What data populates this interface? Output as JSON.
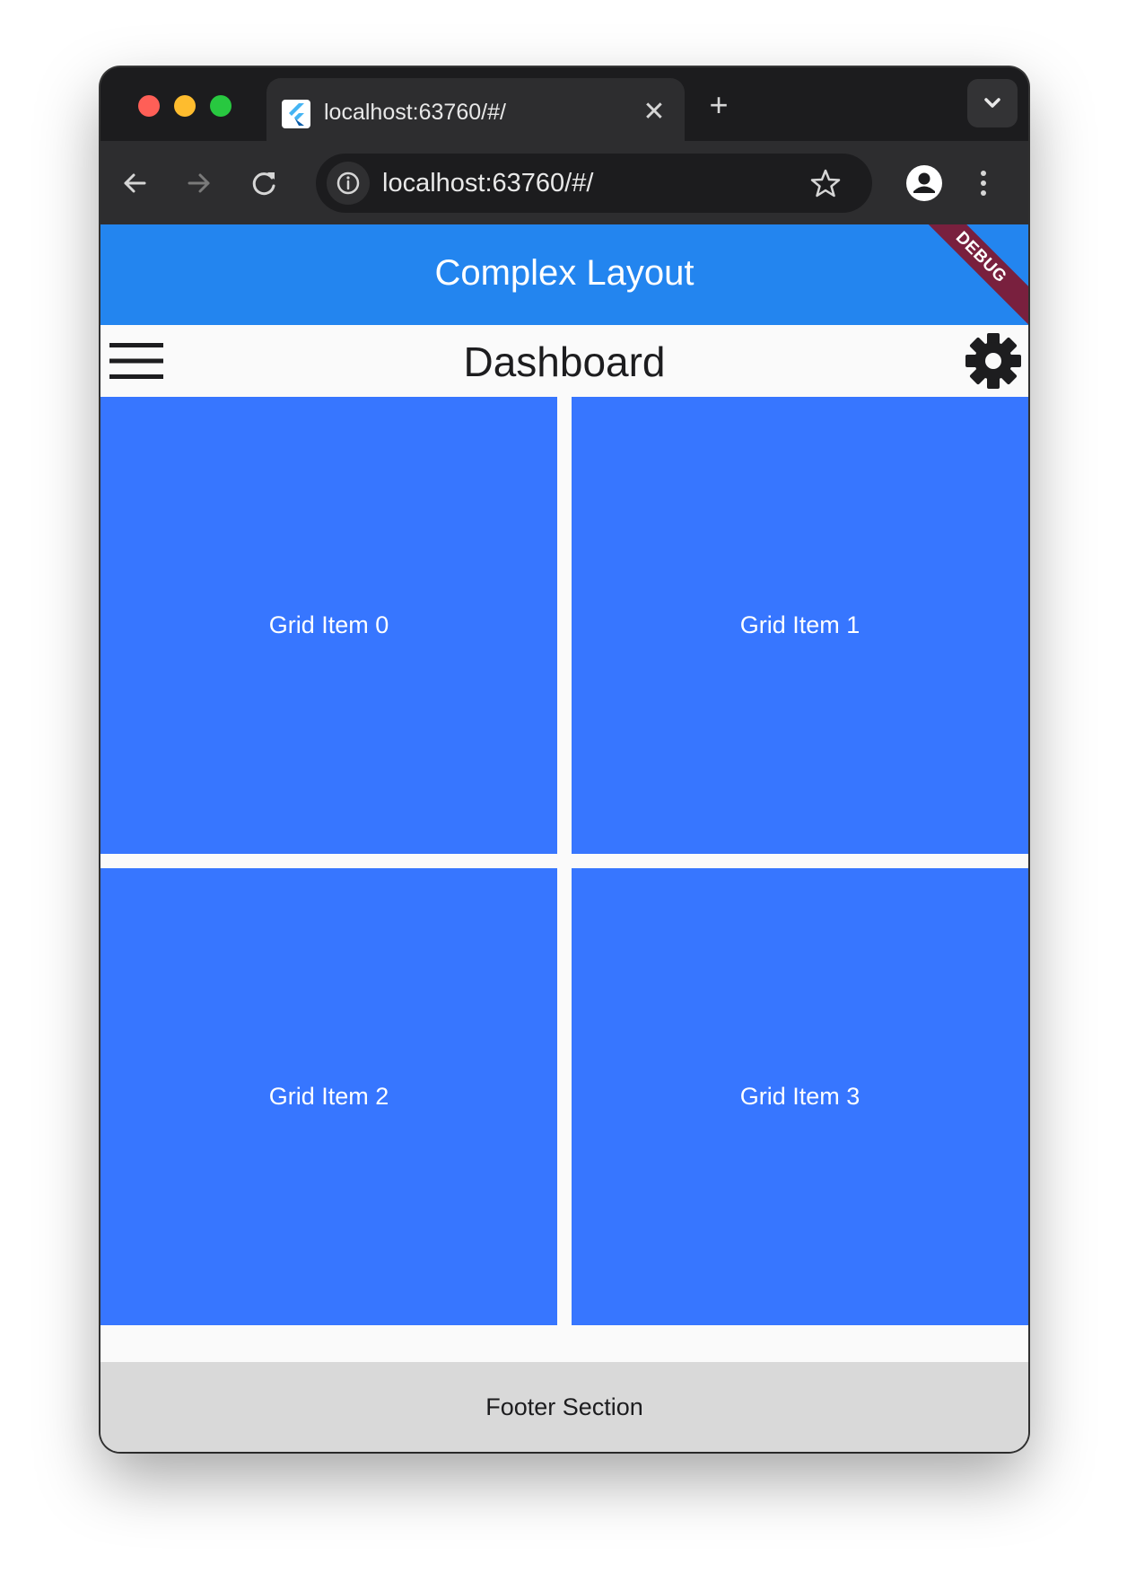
{
  "browser": {
    "tab_title": "localhost:63760/#/",
    "tab_close": "✕",
    "new_tab": "+",
    "url": "localhost:63760/#/"
  },
  "app": {
    "appbar_title": "Complex Layout",
    "debug_banner": "DEBUG",
    "dashboard_title": "Dashboard",
    "grid_items": [
      "Grid Item 0",
      "Grid Item 1",
      "Grid Item 2",
      "Grid Item 3"
    ],
    "footer_text": "Footer Section"
  },
  "colors": {
    "appbar": "#2385ef",
    "grid_item": "#3776ff",
    "footer": "#d9d9d9",
    "debug_banner": "#79203e"
  },
  "icons": {
    "menu": "hamburger-menu-icon",
    "settings": "gear-icon",
    "back": "arrow-left-icon",
    "forward": "arrow-right-icon",
    "reload": "reload-icon",
    "bookmark": "star-icon",
    "profile": "person-icon",
    "more": "vertical-dots-icon"
  }
}
